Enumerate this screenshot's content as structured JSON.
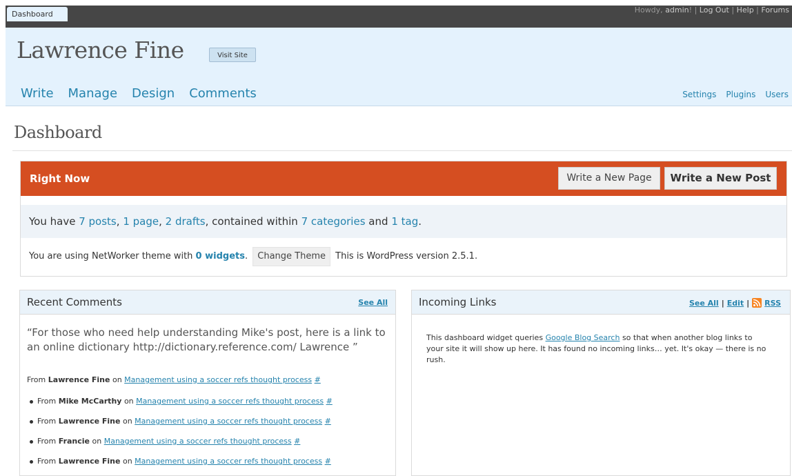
{
  "topbar": {
    "tab": "Dashboard",
    "howdy": "Howdy,",
    "user": "admin",
    "sep1": "! |",
    "logout": "Log Out",
    "sep2": "|",
    "help": "Help",
    "sep3": "|",
    "forums": "Forums"
  },
  "header": {
    "site_title": "Lawrence Fine",
    "visit_site": "Visit Site",
    "main_nav": [
      "Write",
      "Manage",
      "Design",
      "Comments"
    ],
    "side_nav": [
      "Settings",
      "Plugins",
      "Users"
    ]
  },
  "page_title": "Dashboard",
  "right_now": {
    "title": "Right Now",
    "write_page": "Write a New Page",
    "write_post": "Write a New Post",
    "stats": {
      "prefix": "You have",
      "posts": "7 posts",
      "c1": ",",
      "page": "1 page",
      "c2": ",",
      "drafts": "2 drafts",
      "mid": ", contained within",
      "categories": "7 categories",
      "and": "and",
      "tag": "1 tag",
      "end": "."
    },
    "theme": {
      "prefix": "You are using NetWorker theme with",
      "widgets": "0 widgets",
      "dot": ".",
      "change_theme": "Change Theme",
      "version": "This is WordPress version 2.5.1."
    }
  },
  "recent_comments": {
    "title": "Recent Comments",
    "see_all": "See All",
    "quote": "“For those who need help understanding Mike's post, here is a link to an online dictionary http://dictionary.reference.com/ Lawrence ”",
    "first": {
      "from": "From",
      "author": "Lawrence Fine",
      "on": "on",
      "post": "Management using a soccer refs thought process",
      "hash": "#"
    },
    "items": [
      {
        "from": "From",
        "author": "Mike McCarthy",
        "on": "on",
        "post": "Management using a soccer refs thought process",
        "hash": "#"
      },
      {
        "from": "From",
        "author": "Lawrence Fine",
        "on": "on",
        "post": "Management using a soccer refs thought process",
        "hash": "#"
      },
      {
        "from": "From",
        "author": "Francie",
        "on": "on",
        "post": "Management using a soccer refs thought process",
        "hash": "#"
      },
      {
        "from": "From",
        "author": "Lawrence Fine",
        "on": "on",
        "post": "Management using a soccer refs thought process",
        "hash": "#"
      }
    ]
  },
  "incoming_links": {
    "title": "Incoming Links",
    "see_all": "See All",
    "sep1": "|",
    "edit": "Edit",
    "sep2": "|",
    "rss": "RSS",
    "text_prefix": "This dashboard widget queries",
    "text_link": "Google Blog Search",
    "text_suffix": "so that when another blog links to your site it will show up here. It has found no incoming links… yet. It's okay — there is no rush."
  },
  "colors": {
    "accent": "#d54e21",
    "link": "#2583ad",
    "header_bg": "#e4f2fd",
    "topbar_bg": "#464646",
    "rss": "#f78422"
  }
}
